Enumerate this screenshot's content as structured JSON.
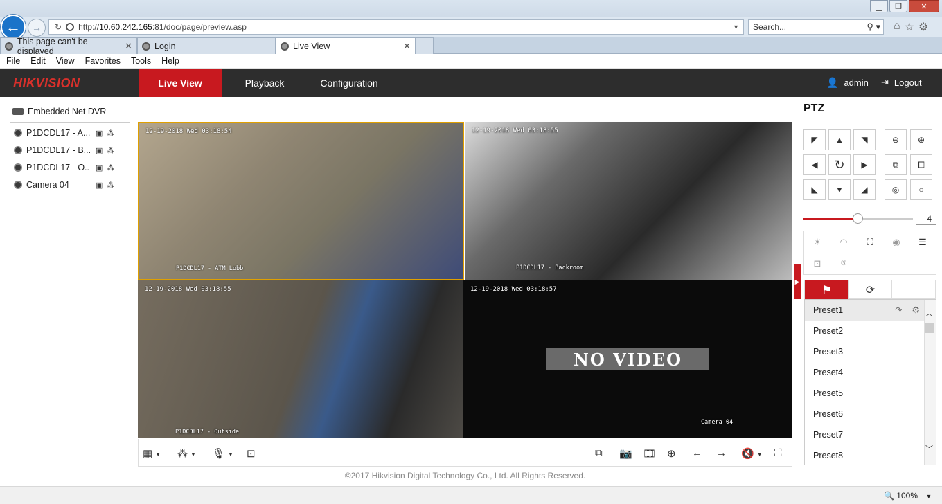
{
  "browser": {
    "url_prefix": "http://",
    "url_host": "10.60.242.165",
    "url_rest": ":81/doc/page/preview.asp",
    "search_placeholder": "Search...",
    "tabs": [
      {
        "label": "This page can't be displayed"
      },
      {
        "label": "Login"
      },
      {
        "label": "Live View"
      }
    ],
    "menu": [
      "File",
      "Edit",
      "View",
      "Favorites",
      "Tools",
      "Help"
    ],
    "zoom": "100%"
  },
  "app": {
    "logo_red": "HIK",
    "logo_white": "VISION",
    "nav": [
      "Live View",
      "Playback",
      "Configuration"
    ],
    "user": "admin",
    "logout": "Logout",
    "accent": "#c8191f"
  },
  "tree": {
    "root": "Embedded Net DVR",
    "cameras": [
      "P1DCDL17 - A...",
      "P1DCDL17 - B...",
      "P1DCDL17 - O...",
      "Camera 04"
    ]
  },
  "video": {
    "tiles": [
      {
        "timestamp": "12-19-2018 Wed 03:18:54",
        "name": "P1DCDL17 - ATM Lobb"
      },
      {
        "timestamp": "12-19-2018 Wed 03:18:55",
        "name": "P1DCDL17 - Backroom"
      },
      {
        "timestamp": "12-19-2018 Wed 03:18:55",
        "name": "P1DCDL17 - Outside"
      },
      {
        "timestamp": "12-19-2018 Wed 03:18:57",
        "name": "Camera 04",
        "overlay": "NO VIDEO"
      }
    ]
  },
  "footer": {
    "copyright": "©2017 Hikvision Digital Technology Co., Ltd. All Rights Reserved."
  },
  "ptz": {
    "title": "PTZ",
    "speed": "4",
    "speed_fraction": 0.5,
    "presets": [
      "Preset1",
      "Preset2",
      "Preset3",
      "Preset4",
      "Preset5",
      "Preset6",
      "Preset7",
      "Preset8"
    ]
  }
}
